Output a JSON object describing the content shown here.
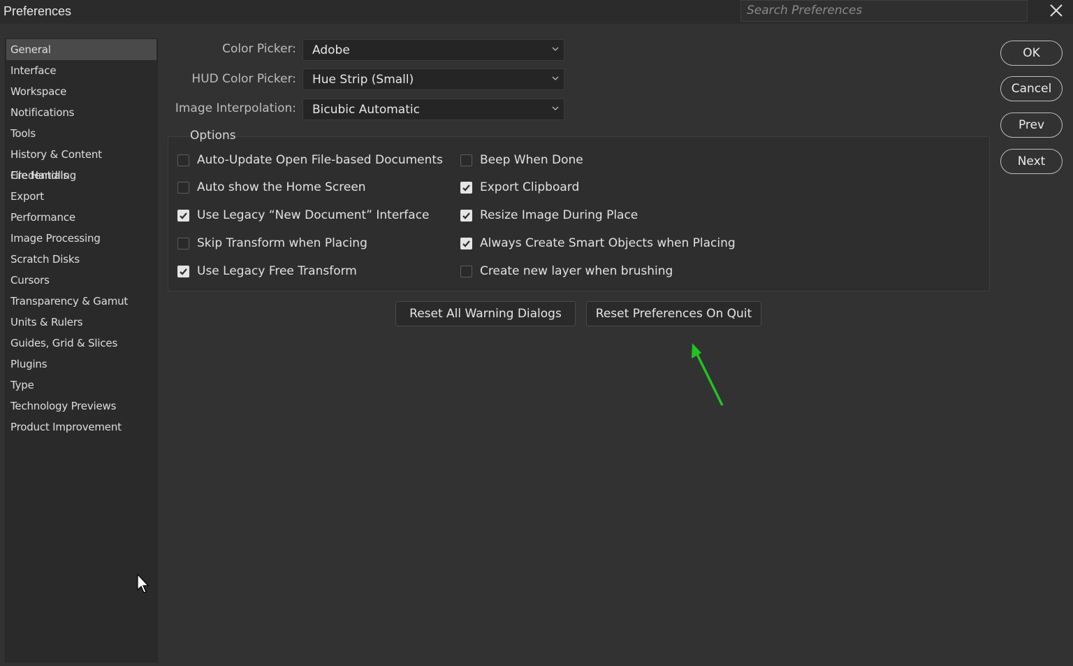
{
  "window": {
    "title": "Preferences",
    "search_placeholder": "Search Preferences"
  },
  "sidebar": {
    "items": [
      {
        "label": "General",
        "selected": true
      },
      {
        "label": "Interface"
      },
      {
        "label": "Workspace"
      },
      {
        "label": "Notifications"
      },
      {
        "label": "Tools"
      },
      {
        "label": "History & Content Credentials"
      },
      {
        "label": "File Handling"
      },
      {
        "label": "Export"
      },
      {
        "label": "Performance"
      },
      {
        "label": "Image Processing"
      },
      {
        "label": "Scratch Disks"
      },
      {
        "label": "Cursors"
      },
      {
        "label": "Transparency & Gamut"
      },
      {
        "label": "Units & Rulers"
      },
      {
        "label": "Guides, Grid & Slices"
      },
      {
        "label": "Plugins"
      },
      {
        "label": "Type"
      },
      {
        "label": "Technology Previews"
      },
      {
        "label": "Product Improvement"
      }
    ]
  },
  "general": {
    "color_picker": {
      "label": "Color Picker:",
      "value": "Adobe"
    },
    "hud_color_picker": {
      "label": "HUD Color Picker:",
      "value": "Hue Strip (Small)"
    },
    "image_interpolation": {
      "label": "Image Interpolation:",
      "value": "Bicubic Automatic"
    },
    "options_label": "Options",
    "options_left": [
      {
        "label": "Auto-Update Open File-based Documents",
        "checked": false
      },
      {
        "label": "Auto show the Home Screen",
        "checked": false
      },
      {
        "label": "Use Legacy “New Document” Interface",
        "checked": true
      },
      {
        "label": "Skip Transform when Placing",
        "checked": false
      },
      {
        "label": "Use Legacy Free Transform",
        "checked": true
      }
    ],
    "options_right": [
      {
        "label": "Beep When Done",
        "checked": false
      },
      {
        "label": "Export Clipboard",
        "checked": true
      },
      {
        "label": "Resize Image During Place",
        "checked": true
      },
      {
        "label": "Always Create Smart Objects when Placing",
        "checked": true
      },
      {
        "label": "Create new layer when brushing",
        "checked": false
      }
    ],
    "reset_warning_label": "Reset All Warning Dialogs",
    "reset_prefs_label": "Reset Preferences On Quit"
  },
  "actions": {
    "ok": "OK",
    "cancel": "Cancel",
    "prev": "Prev",
    "next": "Next"
  },
  "colors": {
    "annotation_arrow": "#1fc41f"
  }
}
